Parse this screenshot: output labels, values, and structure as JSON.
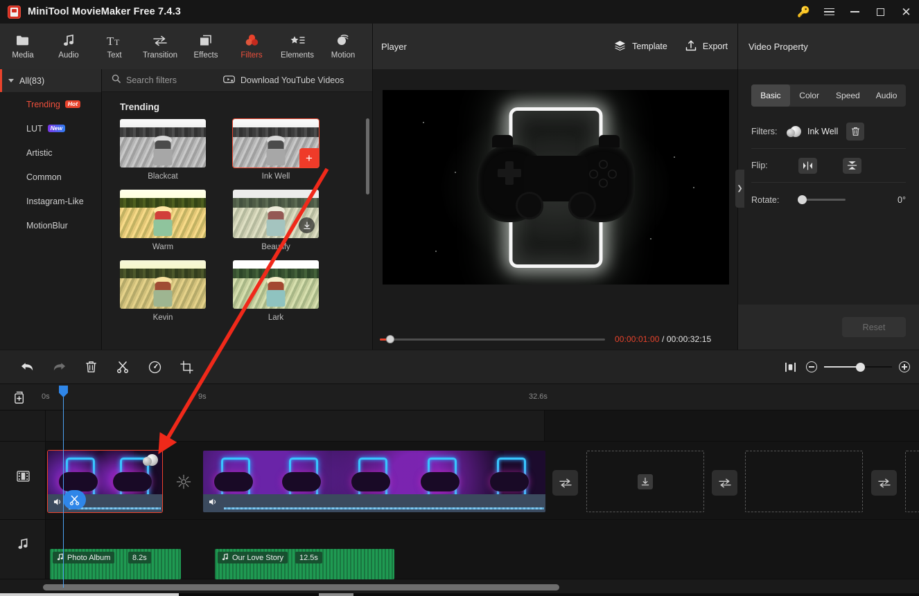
{
  "window": {
    "title": "MiniTool MovieMaker Free 7.4.3",
    "controls": {
      "key": "key-icon",
      "menu": "menu-icon",
      "minimize": "minimize-icon",
      "maximize": "maximize-icon",
      "close": "close-icon"
    }
  },
  "toolbar": {
    "items": [
      {
        "label": "Media",
        "icon": "folder-icon"
      },
      {
        "label": "Audio",
        "icon": "music-note-icon"
      },
      {
        "label": "Text",
        "icon": "text-icon"
      },
      {
        "label": "Transition",
        "icon": "transition-arrows-icon"
      },
      {
        "label": "Effects",
        "icon": "effects-squares-icon"
      },
      {
        "label": "Filters",
        "icon": "filters-circles-icon"
      },
      {
        "label": "Elements",
        "icon": "star-list-icon"
      },
      {
        "label": "Motion",
        "icon": "motion-ball-icon"
      }
    ],
    "active": "Filters",
    "accent": "#f0503c"
  },
  "sidebar": {
    "all_label": "All(83)",
    "items": [
      {
        "label": "Trending",
        "badge": "Hot",
        "badge_type": "hot",
        "active": true
      },
      {
        "label": "LUT",
        "badge": "New",
        "badge_type": "new",
        "active": false
      },
      {
        "label": "Artistic",
        "badge": "",
        "badge_type": "",
        "active": false
      },
      {
        "label": "Common",
        "badge": "",
        "badge_type": "",
        "active": false
      },
      {
        "label": "Instagram-Like",
        "badge": "",
        "badge_type": "",
        "active": false
      },
      {
        "label": "MotionBlur",
        "badge": "",
        "badge_type": "",
        "active": false
      }
    ]
  },
  "browser": {
    "search_placeholder": "Search filters",
    "search_value": "",
    "search_icon": "search-icon",
    "download_label": "Download YouTube Videos",
    "download_icon": "youtube-download-icon",
    "section_title": "Trending",
    "filters": [
      {
        "name": "Blackcat",
        "style": "gs",
        "selected": false,
        "overlay": "none"
      },
      {
        "name": "Ink Well",
        "style": "gs",
        "selected": true,
        "overlay": "plus"
      },
      {
        "name": "Warm",
        "style": "warmf",
        "selected": false,
        "overlay": "none"
      },
      {
        "name": "Beautify",
        "style": "beautyf",
        "selected": false,
        "overlay": "download"
      },
      {
        "name": "Kevin",
        "style": "kevinf",
        "selected": false,
        "overlay": "none"
      },
      {
        "name": "Lark",
        "style": "larkf",
        "selected": false,
        "overlay": "none"
      }
    ]
  },
  "player": {
    "title": "Player",
    "template_label": "Template",
    "template_icon": "layers-icon",
    "export_label": "Export",
    "export_icon": "export-upload-icon",
    "current_time": "00:00:01:00",
    "separator": "/",
    "total_time": "00:00:32:15",
    "aspect_ratio": "16:9",
    "controls": {
      "play": "play-icon",
      "prev_frame": "previous-frame-icon",
      "next_frame": "next-frame-icon",
      "stop": "stop-icon",
      "volume": "volume-icon",
      "fullscreen": "fullscreen-icon",
      "dropdown": "chevron-down-icon"
    }
  },
  "property": {
    "title": "Video Property",
    "tabs": [
      {
        "label": "Basic",
        "active": true
      },
      {
        "label": "Color",
        "active": false
      },
      {
        "label": "Speed",
        "active": false
      },
      {
        "label": "Audio",
        "active": false
      }
    ],
    "filters_label": "Filters:",
    "filter_value": "Ink Well",
    "delete_icon": "trash-icon",
    "flip_label": "Flip:",
    "flip_horizontal_icon": "flip-horizontal-icon",
    "flip_vertical_icon": "flip-vertical-icon",
    "rotate_label": "Rotate:",
    "rotate_value": "0°",
    "reset_label": "Reset",
    "collapse_icon": "chevron-right-icon"
  },
  "timeline": {
    "tools": [
      {
        "name": "undo",
        "icon": "undo-arrow-icon",
        "enabled": true
      },
      {
        "name": "redo",
        "icon": "redo-arrow-icon",
        "enabled": false
      },
      {
        "name": "delete",
        "icon": "trash-icon",
        "enabled": true
      },
      {
        "name": "split",
        "icon": "scissors-icon",
        "enabled": true
      },
      {
        "name": "speed",
        "icon": "speedometer-icon",
        "enabled": true
      },
      {
        "name": "crop",
        "icon": "crop-icon",
        "enabled": true
      }
    ],
    "zoom": {
      "fit_icon": "fit-to-timeline-icon",
      "minus_icon": "zoom-out-icon",
      "plus_icon": "zoom-in-icon",
      "value": 52
    },
    "add_track_icon": "add-media-icon",
    "ruler_ticks": [
      "0s",
      "9s",
      "32.6s"
    ],
    "video_track_icon": "film-strip-icon",
    "audio_track_icon": "music-note-icon",
    "video_clips": [
      {
        "name": "clip-1",
        "selected": true,
        "has_filter_chip": true,
        "has_scissors": true
      },
      {
        "name": "clip-2",
        "selected": false,
        "has_filter_chip": false,
        "has_scissors": false
      }
    ],
    "transition_slots": [
      "transition-1",
      "transition-2",
      "transition-3",
      "transition-4"
    ],
    "placeholders": [
      "placeholder-1",
      "placeholder-2",
      "placeholder-3"
    ],
    "audio_clips": [
      {
        "title": "Photo Album",
        "duration": "8.2s"
      },
      {
        "title": "Our Love Story",
        "duration": "12.5s"
      }
    ]
  },
  "annotation": {
    "type": "drag-arrow",
    "color": "#f0291a"
  }
}
